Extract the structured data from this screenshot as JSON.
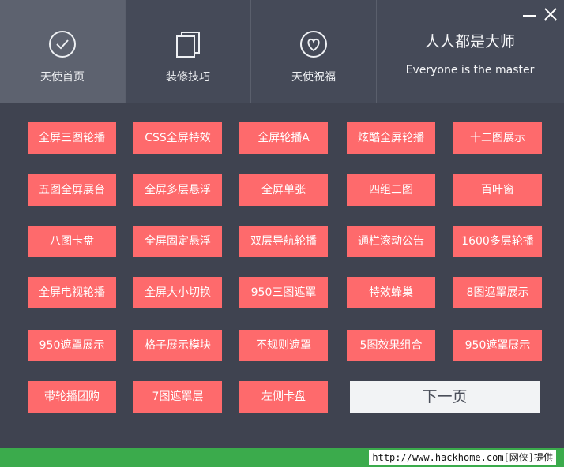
{
  "tabs": [
    {
      "label": "天使首页",
      "icon": "check-circle-icon"
    },
    {
      "label": "装修技巧",
      "icon": "stacked-pages-icon"
    },
    {
      "label": "天使祝福",
      "icon": "heart-circle-icon"
    }
  ],
  "brand": {
    "title": "人人都是大师",
    "subtitle": "Everyone  is the master"
  },
  "buttons": [
    [
      "全屏三图轮播",
      "CSS全屏特效",
      "全屏轮播A",
      "炫酷全屏轮播",
      "十二图展示"
    ],
    [
      "五图全屏展台",
      "全屏多层悬浮",
      "全屏单张",
      "四组三图",
      "百叶窗"
    ],
    [
      "八图卡盘",
      "全屏固定悬浮",
      "双层导航轮播",
      "通栏滚动公告",
      "1600多层轮播"
    ],
    [
      "全屏电视轮播",
      "全屏大小切换",
      "950三图遮罩",
      "特效蜂巢",
      "8图遮罩展示"
    ],
    [
      "950遮罩展示",
      "格子展示模块",
      "不规则遮罩",
      "5图效果组合",
      "950遮罩展示"
    ],
    [
      "带轮播团购",
      "7图遮罩层",
      "左侧卡盘"
    ]
  ],
  "next_label": "下一页",
  "footer_text": "http://www.hackhome.com[网侠]提供",
  "colors": {
    "accent": "#fe6a6c",
    "background": "#3f4350",
    "header": "#454a58",
    "active_tab": "#5d626f",
    "frame": "#3bab4c"
  }
}
